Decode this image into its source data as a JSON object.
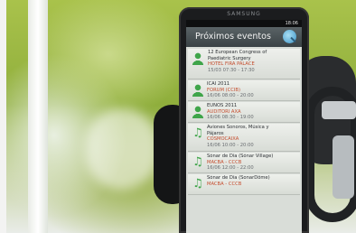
{
  "phone": {
    "brand": "SAMSUNG",
    "status_time": "18:06",
    "app_title": "Próximos eventos",
    "events": [
      {
        "icon": "person-icon",
        "title": "12 European Congress of",
        "title2": "Paediatric Surgery",
        "venue": "HOTEL FIRA PALACE",
        "date": "15/03 07:30 - 17:30"
      },
      {
        "icon": "person-icon",
        "title": "ICAI 2011",
        "title2": "",
        "venue": "FORUM (CCIB)",
        "date": "16/06 08:00 - 20:00"
      },
      {
        "icon": "person-icon",
        "title": "EUNOS 2011",
        "title2": "",
        "venue": "AUDITORI AXA",
        "date": "16/06 08:30 - 19:00"
      },
      {
        "icon": "music-note-icon",
        "title": "Aviones Sonoros, Música y",
        "title2": "Pájaros",
        "venue": "COSMOCAIXA",
        "date": "16/06 10:00 - 20:00"
      },
      {
        "icon": "music-note-icon",
        "title": "Sónar de Día (Sónar Village)",
        "title2": "",
        "venue": "MACBA - CCCB",
        "date": "16/06 12:00 - 22:00"
      },
      {
        "icon": "music-note-icon",
        "title": "Sónar de Día (SonarDôme)",
        "title2": "",
        "venue": "MACBA - CCCB",
        "date": ""
      }
    ]
  }
}
